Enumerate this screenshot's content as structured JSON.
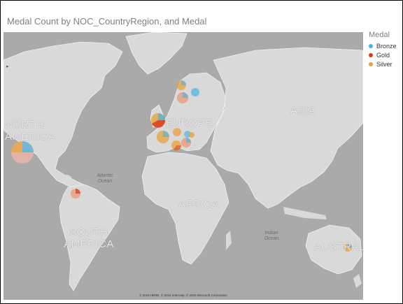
{
  "visual": {
    "title": "Medal Count by NOC_CountryRegion, and Medal"
  },
  "legend": {
    "title": "Medal",
    "items": [
      {
        "label": "Bronze",
        "color": "#42b4e6"
      },
      {
        "label": "Gold",
        "color": "#d83b1f"
      },
      {
        "label": "Silver",
        "color": "#e8a239"
      }
    ]
  },
  "map": {
    "continent_labels": {
      "north_america": "NORTH AMERICA",
      "europe": "EUROPE",
      "asia": "ASIA",
      "africa": "AFRICA",
      "south_america": "SOUTH AMERICA",
      "australia": "AUSTRALIA"
    },
    "ocean_labels": {
      "atlantic": "Atlantic Ocean",
      "indian": "Indian Ocean"
    },
    "copyright": "© 2016 HERE, © 2016 Intermap, © 2016 Microsoft Corporation"
  },
  "colors": {
    "land": "#d9d9d9",
    "water": "#aaaaaa",
    "bronze": "#42b4e6",
    "gold": "#d83b1f",
    "silver": "#e8a239"
  }
}
